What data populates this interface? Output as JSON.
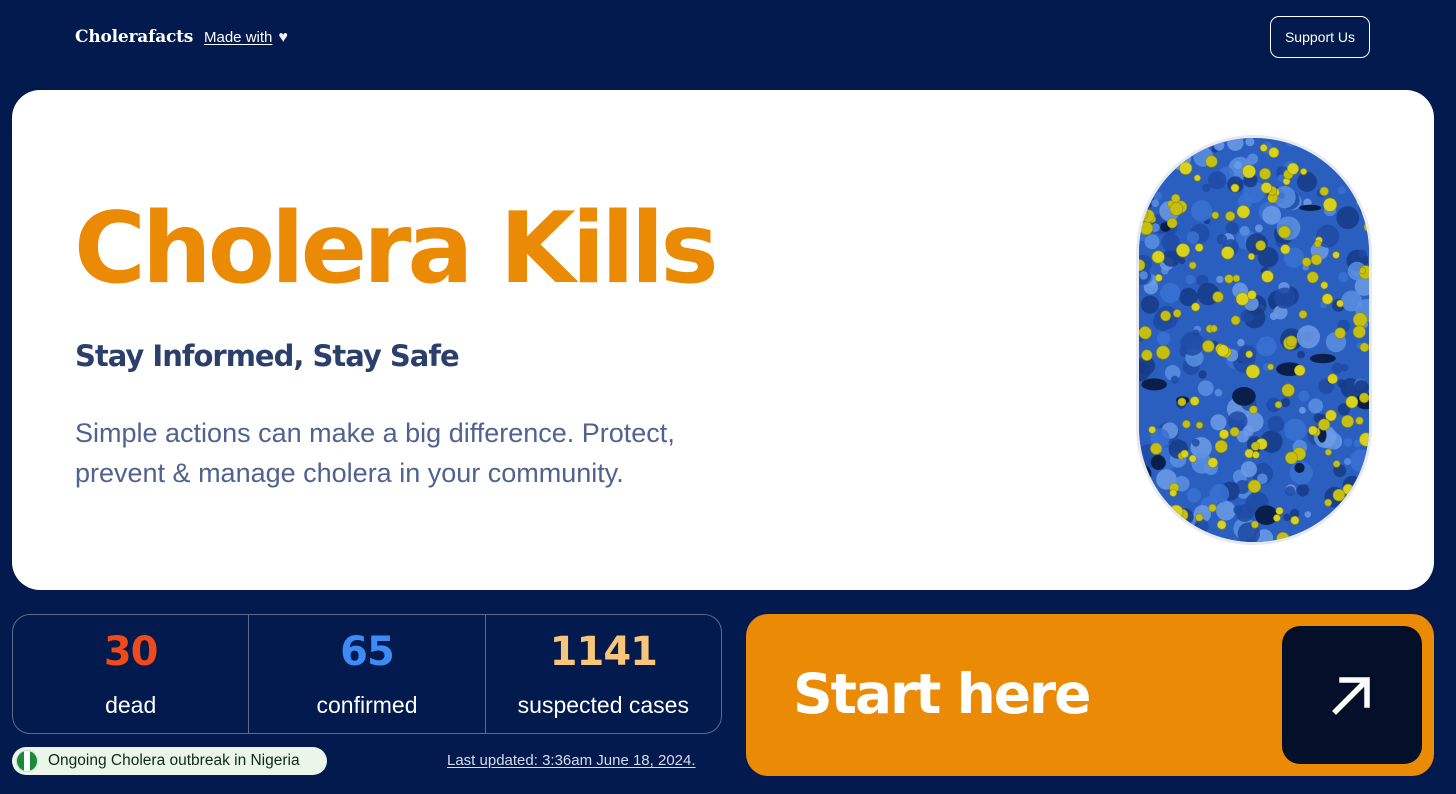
{
  "header": {
    "brand": "Cholerafacts",
    "made_with": "Made with",
    "heart_icon": "heart-icon",
    "support_label": "Support Us"
  },
  "hero": {
    "title": "Cholera Kills",
    "subtitle": "Stay Informed, Stay Safe",
    "description": "Simple actions can make a big difference. Protect, prevent & manage cholera in your community.",
    "image": "cholera-bacteria-microscopy"
  },
  "stats": [
    {
      "value": "30",
      "label": "dead",
      "color": "#f04a1a"
    },
    {
      "value": "65",
      "label": "confirmed",
      "color": "#3d8cf5"
    },
    {
      "value": "1141",
      "label": "suspected cases",
      "color": "#f7c67a"
    }
  ],
  "outbreak": {
    "text": "Ongoing Cholera outbreak in Nigeria",
    "flag_icon": "nigeria-flag-icon"
  },
  "last_updated": "Last updated: 3:36am June 18, 2024.",
  "cta": {
    "label": "Start here",
    "arrow_icon": "arrow-up-right-icon"
  },
  "colors": {
    "background": "#021a4d",
    "accent": "#ea8a05",
    "hero_card": "#ffffff"
  }
}
